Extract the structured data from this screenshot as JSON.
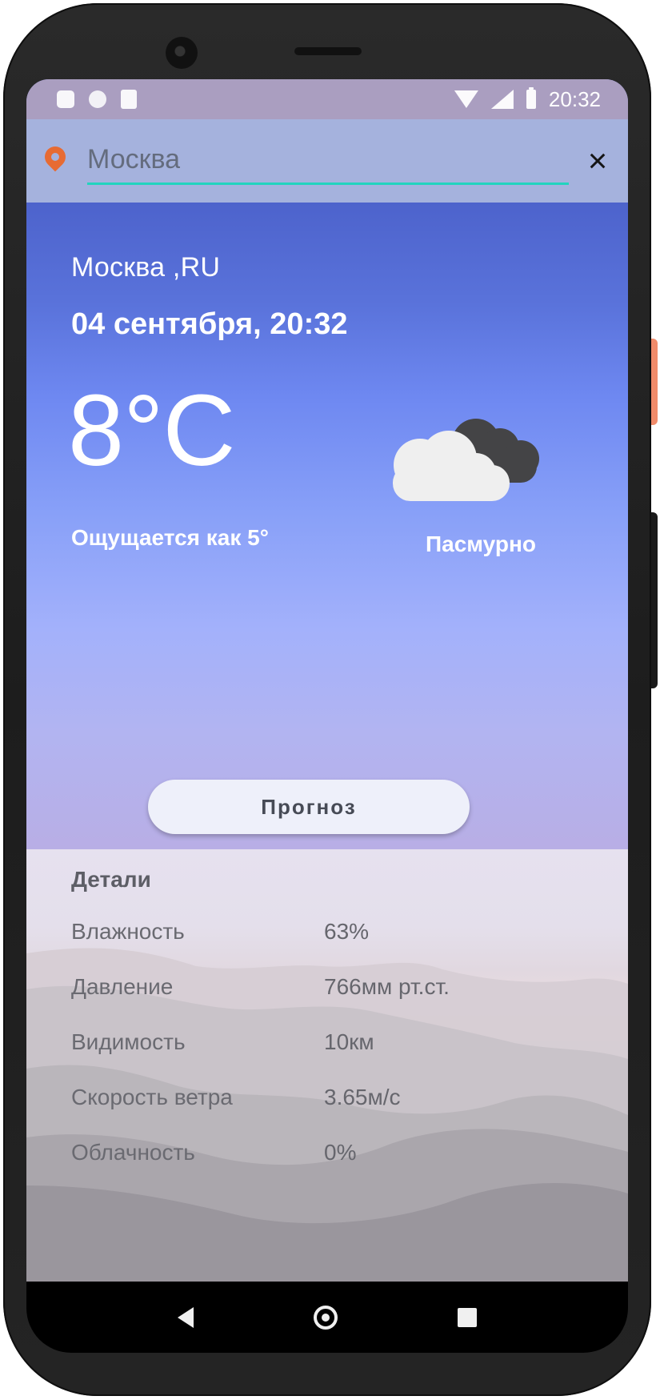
{
  "status_bar": {
    "time": "20:32",
    "left_icons": [
      "keyboard-icon",
      "settings-icon",
      "sd-card-icon"
    ],
    "right_icons": [
      "wifi-icon",
      "signal-icon",
      "battery-icon"
    ]
  },
  "search": {
    "value": "Москва",
    "placeholder": "Москва",
    "clear_icon": "close-icon"
  },
  "weather": {
    "city": "Москва ,RU",
    "datetime": "04 сентября, 20:32",
    "temperature": "8°C",
    "feels_like": "Ощущается как 5°",
    "condition": "Пасмурно",
    "forecast_button": "Прогноз",
    "icon": "cloudy-icon"
  },
  "details": {
    "title": "Детали",
    "rows": [
      {
        "label": "Влажность",
        "value": "63%"
      },
      {
        "label": "Давление",
        "value": "766мм рт.ст."
      },
      {
        "label": "Видимость",
        "value": "10км"
      },
      {
        "label": "Скорость ветра",
        "value": "3.65м/с"
      },
      {
        "label": "Облачность",
        "value": "0%"
      }
    ]
  },
  "navigation": {
    "back_icon": "back-icon",
    "home_icon": "home-icon",
    "recents_icon": "recents-icon"
  },
  "colors": {
    "accent": "#22d4be",
    "pin": "#e76b33",
    "hero_top": "#4d63cc",
    "hero_bottom": "#b8aee5"
  }
}
